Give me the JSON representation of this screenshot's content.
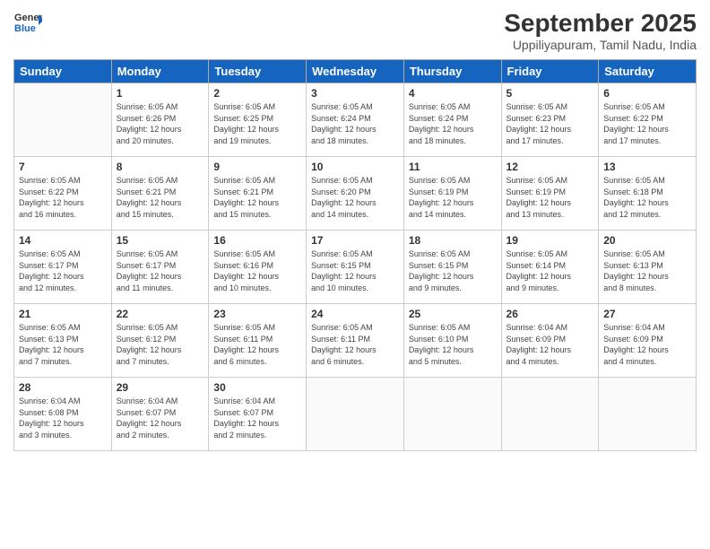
{
  "header": {
    "logo": {
      "line1": "General",
      "line2": "Blue"
    },
    "title": "September 2025",
    "location": "Uppiliyapuram, Tamil Nadu, India"
  },
  "weekdays": [
    "Sunday",
    "Monday",
    "Tuesday",
    "Wednesday",
    "Thursday",
    "Friday",
    "Saturday"
  ],
  "weeks": [
    [
      {
        "day": "",
        "info": ""
      },
      {
        "day": "1",
        "info": "Sunrise: 6:05 AM\nSunset: 6:26 PM\nDaylight: 12 hours\nand 20 minutes."
      },
      {
        "day": "2",
        "info": "Sunrise: 6:05 AM\nSunset: 6:25 PM\nDaylight: 12 hours\nand 19 minutes."
      },
      {
        "day": "3",
        "info": "Sunrise: 6:05 AM\nSunset: 6:24 PM\nDaylight: 12 hours\nand 18 minutes."
      },
      {
        "day": "4",
        "info": "Sunrise: 6:05 AM\nSunset: 6:24 PM\nDaylight: 12 hours\nand 18 minutes."
      },
      {
        "day": "5",
        "info": "Sunrise: 6:05 AM\nSunset: 6:23 PM\nDaylight: 12 hours\nand 17 minutes."
      },
      {
        "day": "6",
        "info": "Sunrise: 6:05 AM\nSunset: 6:22 PM\nDaylight: 12 hours\nand 17 minutes."
      }
    ],
    [
      {
        "day": "7",
        "info": "Sunrise: 6:05 AM\nSunset: 6:22 PM\nDaylight: 12 hours\nand 16 minutes."
      },
      {
        "day": "8",
        "info": "Sunrise: 6:05 AM\nSunset: 6:21 PM\nDaylight: 12 hours\nand 15 minutes."
      },
      {
        "day": "9",
        "info": "Sunrise: 6:05 AM\nSunset: 6:21 PM\nDaylight: 12 hours\nand 15 minutes."
      },
      {
        "day": "10",
        "info": "Sunrise: 6:05 AM\nSunset: 6:20 PM\nDaylight: 12 hours\nand 14 minutes."
      },
      {
        "day": "11",
        "info": "Sunrise: 6:05 AM\nSunset: 6:19 PM\nDaylight: 12 hours\nand 14 minutes."
      },
      {
        "day": "12",
        "info": "Sunrise: 6:05 AM\nSunset: 6:19 PM\nDaylight: 12 hours\nand 13 minutes."
      },
      {
        "day": "13",
        "info": "Sunrise: 6:05 AM\nSunset: 6:18 PM\nDaylight: 12 hours\nand 12 minutes."
      }
    ],
    [
      {
        "day": "14",
        "info": "Sunrise: 6:05 AM\nSunset: 6:17 PM\nDaylight: 12 hours\nand 12 minutes."
      },
      {
        "day": "15",
        "info": "Sunrise: 6:05 AM\nSunset: 6:17 PM\nDaylight: 12 hours\nand 11 minutes."
      },
      {
        "day": "16",
        "info": "Sunrise: 6:05 AM\nSunset: 6:16 PM\nDaylight: 12 hours\nand 10 minutes."
      },
      {
        "day": "17",
        "info": "Sunrise: 6:05 AM\nSunset: 6:15 PM\nDaylight: 12 hours\nand 10 minutes."
      },
      {
        "day": "18",
        "info": "Sunrise: 6:05 AM\nSunset: 6:15 PM\nDaylight: 12 hours\nand 9 minutes."
      },
      {
        "day": "19",
        "info": "Sunrise: 6:05 AM\nSunset: 6:14 PM\nDaylight: 12 hours\nand 9 minutes."
      },
      {
        "day": "20",
        "info": "Sunrise: 6:05 AM\nSunset: 6:13 PM\nDaylight: 12 hours\nand 8 minutes."
      }
    ],
    [
      {
        "day": "21",
        "info": "Sunrise: 6:05 AM\nSunset: 6:13 PM\nDaylight: 12 hours\nand 7 minutes."
      },
      {
        "day": "22",
        "info": "Sunrise: 6:05 AM\nSunset: 6:12 PM\nDaylight: 12 hours\nand 7 minutes."
      },
      {
        "day": "23",
        "info": "Sunrise: 6:05 AM\nSunset: 6:11 PM\nDaylight: 12 hours\nand 6 minutes."
      },
      {
        "day": "24",
        "info": "Sunrise: 6:05 AM\nSunset: 6:11 PM\nDaylight: 12 hours\nand 6 minutes."
      },
      {
        "day": "25",
        "info": "Sunrise: 6:05 AM\nSunset: 6:10 PM\nDaylight: 12 hours\nand 5 minutes."
      },
      {
        "day": "26",
        "info": "Sunrise: 6:04 AM\nSunset: 6:09 PM\nDaylight: 12 hours\nand 4 minutes."
      },
      {
        "day": "27",
        "info": "Sunrise: 6:04 AM\nSunset: 6:09 PM\nDaylight: 12 hours\nand 4 minutes."
      }
    ],
    [
      {
        "day": "28",
        "info": "Sunrise: 6:04 AM\nSunset: 6:08 PM\nDaylight: 12 hours\nand 3 minutes."
      },
      {
        "day": "29",
        "info": "Sunrise: 6:04 AM\nSunset: 6:07 PM\nDaylight: 12 hours\nand 2 minutes."
      },
      {
        "day": "30",
        "info": "Sunrise: 6:04 AM\nSunset: 6:07 PM\nDaylight: 12 hours\nand 2 minutes."
      },
      {
        "day": "",
        "info": ""
      },
      {
        "day": "",
        "info": ""
      },
      {
        "day": "",
        "info": ""
      },
      {
        "day": "",
        "info": ""
      }
    ]
  ]
}
